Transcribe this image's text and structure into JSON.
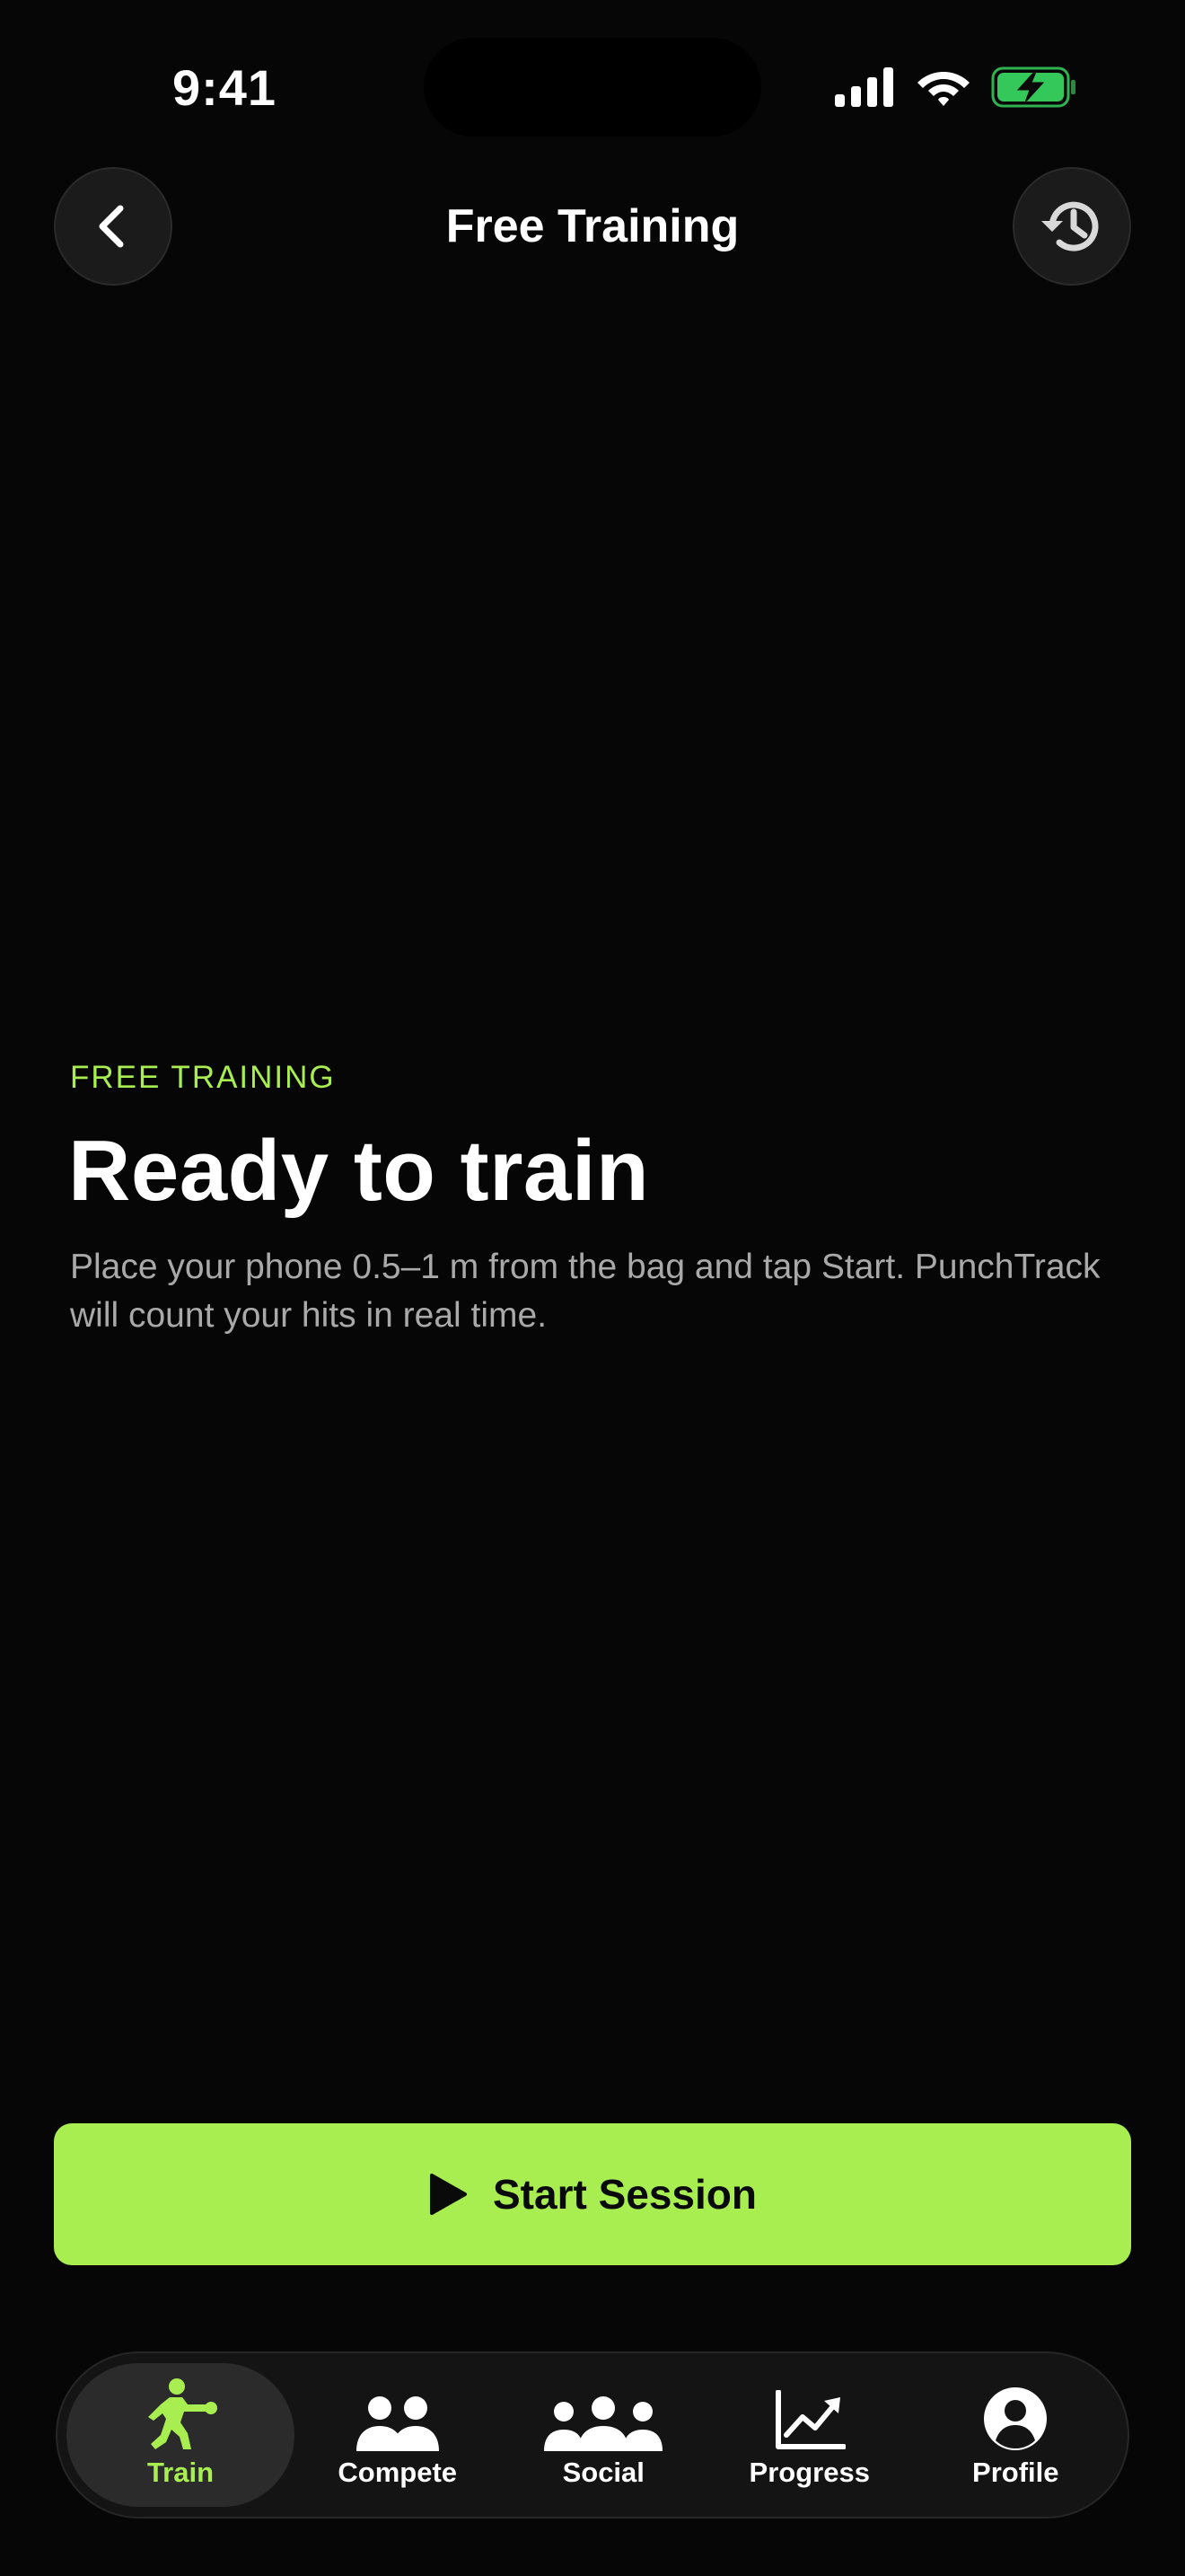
{
  "status_bar": {
    "time": "9:41"
  },
  "header": {
    "title": "Free Training",
    "back_icon": "chevron-left-icon",
    "history_icon": "history-icon"
  },
  "hero": {
    "eyebrow": "FREE TRAINING",
    "headline": "Ready to train",
    "description": "Place your phone 0.5–1 m from the bag and tap Start. PunchTrack will count your hits in real time."
  },
  "cta": {
    "label": "Start Session",
    "icon": "play-icon"
  },
  "tab_bar": {
    "items": [
      {
        "label": "Train",
        "icon": "boxer-icon",
        "active": true
      },
      {
        "label": "Compete",
        "icon": "two-people-icon",
        "active": false
      },
      {
        "label": "Social",
        "icon": "group-icon",
        "active": false
      },
      {
        "label": "Progress",
        "icon": "chart-up-icon",
        "active": false
      },
      {
        "label": "Profile",
        "icon": "person-circle-icon",
        "active": false
      }
    ]
  },
  "colors": {
    "background": "#060606",
    "accent": "#a8ee50",
    "battery_fill": "#34c759",
    "text_secondary": "#a9a9a9"
  }
}
